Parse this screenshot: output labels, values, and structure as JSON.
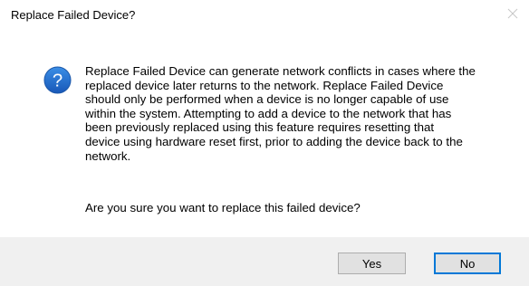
{
  "window": {
    "title": "Replace Failed Device?",
    "close_icon": "close-icon"
  },
  "message": {
    "icon": "question-icon",
    "icon_color": "#1f6fc5",
    "body": "Replace Failed Device can generate network conflicts in cases where the\nreplaced device later returns to the network. Replace Failed Device\nshould only be performed when a device is no longer capable of use\nwithin the system. Attempting to add a device to the network that has\nbeen previously replaced using this feature requires resetting that\ndevice using hardware reset first, prior to adding the device back to the\nnetwork.",
    "question": "Are you sure you want to replace this failed device?"
  },
  "buttons": {
    "yes_label": "Yes",
    "no_label": "No",
    "focus_color": "#0078d7"
  }
}
